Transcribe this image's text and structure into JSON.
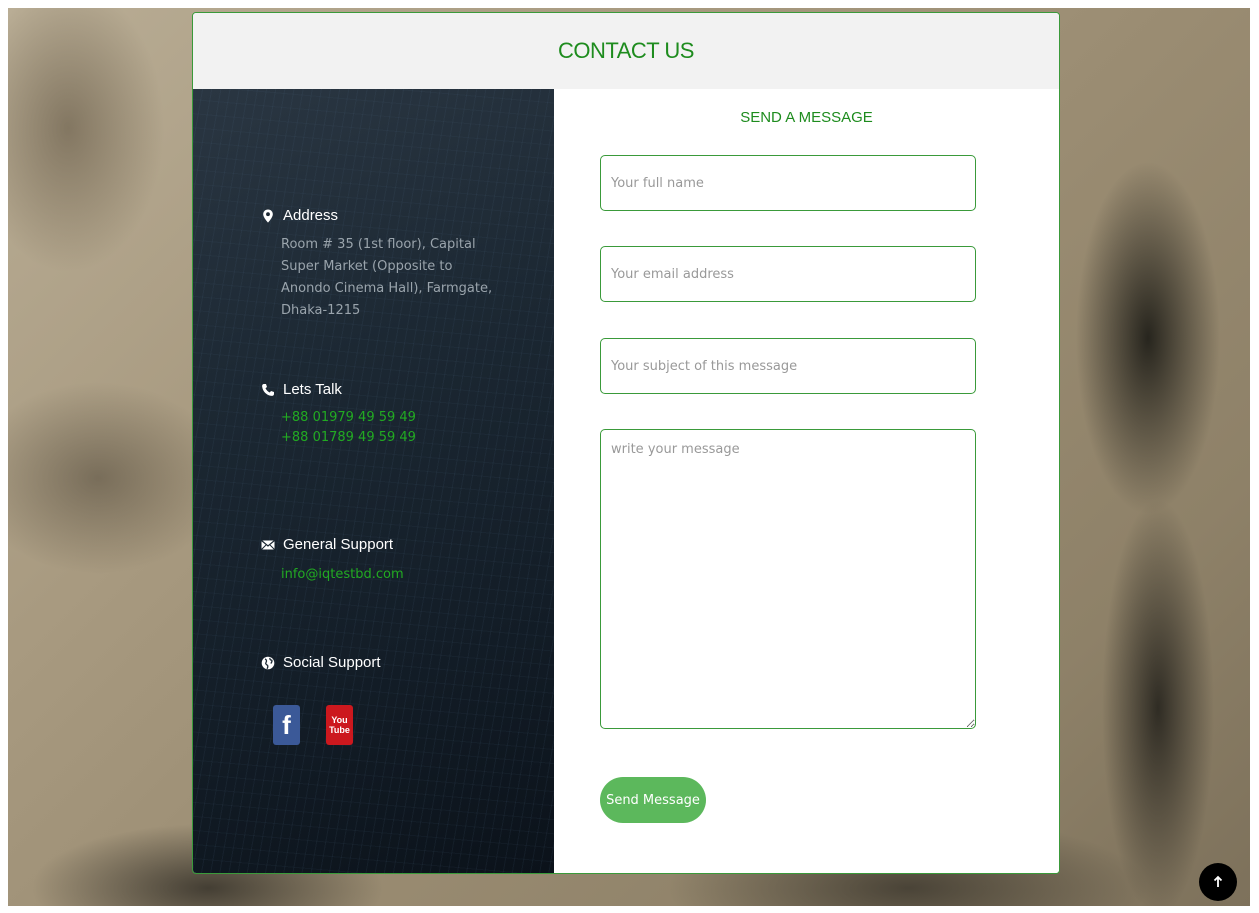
{
  "header": {
    "title": "CONTACT US"
  },
  "info": {
    "address": {
      "icon": "map-marker-icon",
      "heading": "Address",
      "text": "Room # 35 (1st floor), Capital Super Market (Opposite to Anondo Cinema Hall), Farmgate, Dhaka-1215"
    },
    "talk": {
      "icon": "phone-icon",
      "heading": "Lets Talk",
      "phones": [
        "+88 01979 49 59 49",
        "+88 01789 49 59 49"
      ]
    },
    "support": {
      "icon": "envelope-icon",
      "heading": "General Support",
      "email": "info@iqtestbd.com"
    },
    "social": {
      "icon": "globe-icon",
      "heading": "Social Support",
      "facebook_glyph": "f",
      "youtube_top": "You",
      "youtube_bottom": "Tube"
    }
  },
  "form": {
    "title": "SEND A MESSAGE",
    "name_placeholder": "Your full name",
    "email_placeholder": "Your email address",
    "subject_placeholder": "Your subject of this message",
    "message_placeholder": "write your message",
    "submit_label": "Send Message"
  },
  "colors": {
    "accent": "#1e8c1e",
    "button": "#5cb85c",
    "border": "#3a9a3a"
  }
}
